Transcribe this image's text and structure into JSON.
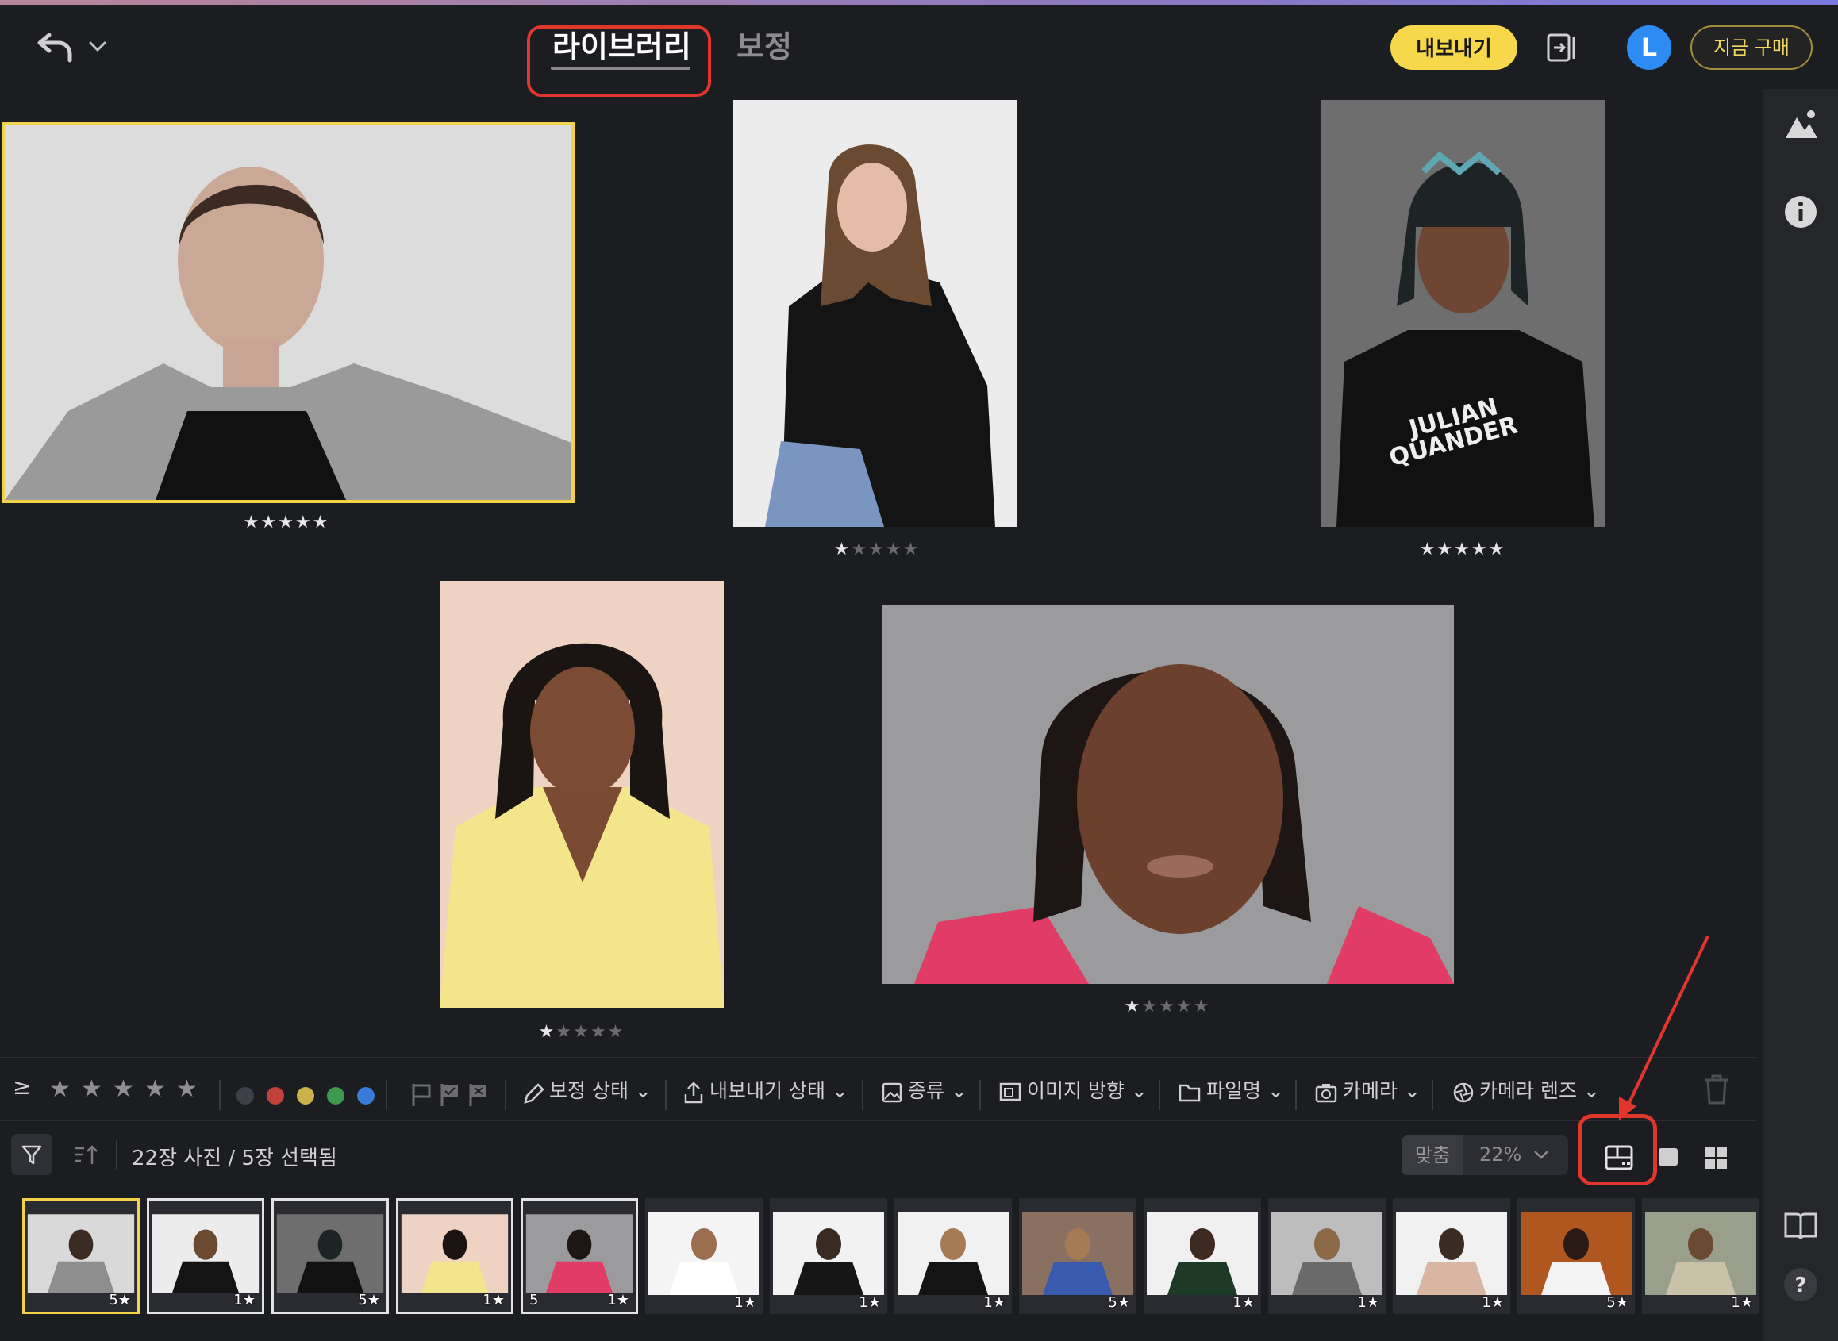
{
  "header": {
    "tabs": [
      {
        "label": "라이브러리",
        "active": true
      },
      {
        "label": "보정",
        "active": false
      }
    ],
    "export_label": "내보내기",
    "avatar_letter": "L",
    "buy_label": "지금 구매"
  },
  "colors": {
    "accent": "#f6d84a",
    "highlight": "#e0362b",
    "avatar": "#2c8cf4"
  },
  "photos": [
    {
      "rating": 5,
      "selected": true
    },
    {
      "rating": 1,
      "selected": false
    },
    {
      "rating": 5,
      "selected": false
    },
    {
      "rating": 1,
      "selected": false
    },
    {
      "rating": 1,
      "selected": false
    }
  ],
  "filter_bar": {
    "op": "≥",
    "color_labels": [
      "#3e4046",
      "#c2403b",
      "#c8b34a",
      "#3f9a50",
      "#3b7ad6"
    ],
    "dropdowns": [
      "보정 상태",
      "내보내기 상태",
      "종류",
      "이미지 방향",
      "파일명",
      "카메라",
      "카메라 렌즈"
    ]
  },
  "toolbar": {
    "count_text": "22장 사진 / 5장 선택됨",
    "fit_label": "맞춤",
    "zoom_label": "22%"
  },
  "filmstrip": {
    "items": [
      {
        "rating": "5",
        "num": ""
      },
      {
        "rating": "1",
        "num": ""
      },
      {
        "rating": "5",
        "num": ""
      },
      {
        "rating": "1",
        "num": ""
      },
      {
        "rating": "1",
        "num": "5"
      },
      {
        "rating": "1",
        "num": ""
      },
      {
        "rating": "1",
        "num": ""
      },
      {
        "rating": "1",
        "num": ""
      },
      {
        "rating": "5",
        "num": ""
      },
      {
        "rating": "1",
        "num": ""
      },
      {
        "rating": "1",
        "num": ""
      },
      {
        "rating": "1",
        "num": ""
      },
      {
        "rating": "5",
        "num": ""
      },
      {
        "rating": "1",
        "num": ""
      }
    ]
  }
}
